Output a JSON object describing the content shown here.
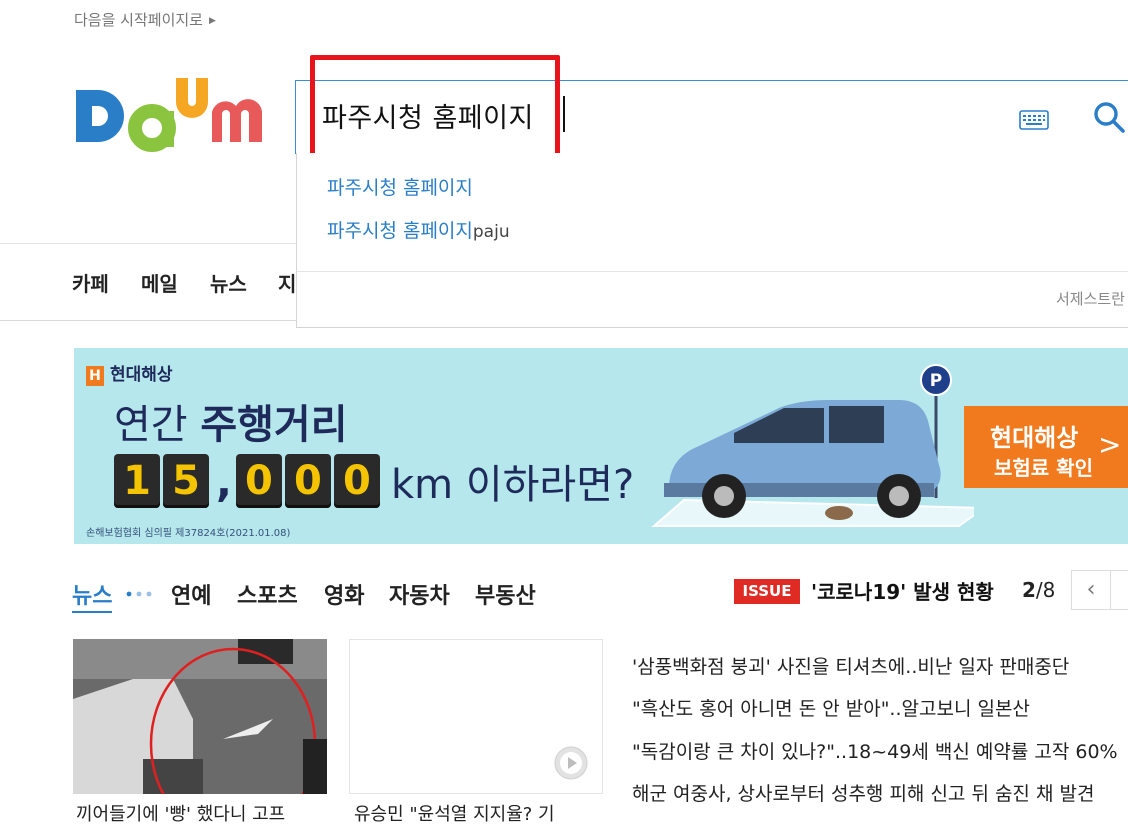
{
  "top": {
    "start_page_link": "다음을 시작페이지로"
  },
  "logo": {
    "letters": [
      "D",
      "a",
      "u",
      "m"
    ],
    "colors": [
      "#2a7ec8",
      "#f5a623",
      "#8bc53f",
      "#e85a5a"
    ]
  },
  "search": {
    "query": "파주시청 홈페이지",
    "keyboard_icon": "keyboard-icon",
    "search_icon": "search-icon",
    "suggestions": [
      {
        "text": "파주시청 홈페이지",
        "suffix": ""
      },
      {
        "text": "파주시청 홈페이지",
        "suffix": "paju"
      }
    ],
    "footer_text": "서제스트란"
  },
  "nav": {
    "items": [
      "카페",
      "메일",
      "뉴스",
      "지"
    ]
  },
  "banner": {
    "brand": "현대해상",
    "brand_mark": "H",
    "line1_light": "연간 ",
    "line1_bold": "주행거리",
    "digits": [
      "1",
      "5",
      "0",
      "0",
      "0"
    ],
    "comma": ",",
    "suffix": "km 이하라면?",
    "fine_print": "손해보험협회 심의필 제37824호(2021.01.08)",
    "cta_line1": "현대해상",
    "cta_line2": "보험료 확인",
    "cta_arrow": ">",
    "parking_label": "P",
    "colors": {
      "bg": "#b5e7ec",
      "cta": "#f07a1d",
      "car": "#7da9d6"
    }
  },
  "news": {
    "tabs": [
      "뉴스",
      "연예",
      "스포츠",
      "영화",
      "자동차",
      "부동산"
    ],
    "issue_badge": "ISSUE",
    "issue_text": "'코로나19' 발생 현황",
    "pager_current": "2",
    "pager_total": "/8",
    "prev_label": "‹",
    "thumb_captions": [
      "끼어들기에 '빵' 했다니 고프",
      "유승민 \"윤석열 지지율? 기"
    ],
    "headlines": [
      "'삼풍백화점 붕괴' 사진을 티셔츠에..비난 일자 판매중단",
      "\"흑산도 홍어 아니면 돈 안 받아\"..알고보니 일본산",
      "\"독감이랑 큰 차이 있나?\"..18~49세 백신 예약률 고작 60%",
      "해군 여중사, 상사로부터 성추행 피해 신고 뒤 숨진 채 발견"
    ]
  }
}
